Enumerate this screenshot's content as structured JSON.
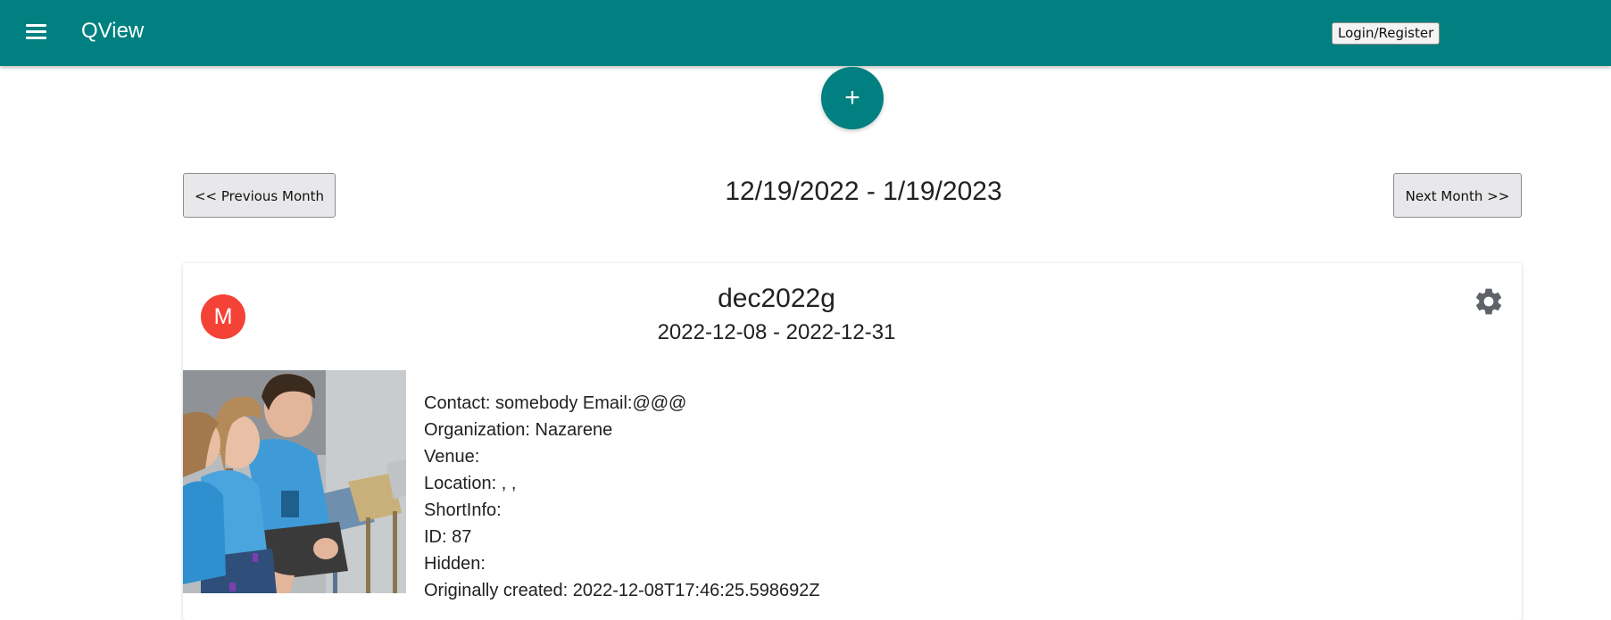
{
  "app": {
    "title": "QView",
    "login_label": "Login/Register"
  },
  "fab": {
    "label": "+"
  },
  "nav": {
    "prev_label": "<< Previous Month",
    "next_label": "Next Month >>",
    "range": "12/19/2022 - 1/19/2023"
  },
  "event": {
    "avatar_letter": "M",
    "title": "dec2022g",
    "dates": "2022-12-08 - 2022-12-31",
    "details": [
      "Contact: somebody Email:@@@",
      "Organization: Nazarene",
      "Venue:",
      "Location: , ,",
      "ShortInfo:",
      "ID: 87",
      "Hidden:",
      "Originally created: 2022-12-08T17:46:25.598692Z"
    ]
  },
  "icons": {
    "menu": "menu-icon",
    "settings": "gear-icon",
    "add": "plus-icon"
  },
  "colors": {
    "primary": "#008080",
    "avatar": "#f44336",
    "gear": "#5f6368"
  }
}
